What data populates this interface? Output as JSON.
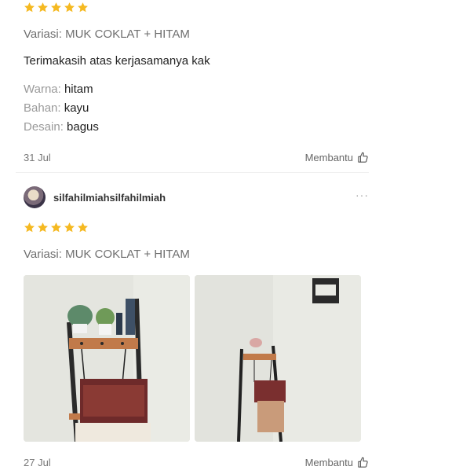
{
  "colors": {
    "star": "#f5b921",
    "text_primary": "#222222",
    "text_muted": "#6f6f6f",
    "attr_key": "#9a9a9a"
  },
  "reviews": [
    {
      "rating": 5,
      "variant": "Variasi: MUK COKLAT + HITAM",
      "comment": "Terimakasih atas kerjasamanya kak",
      "attributes": [
        {
          "key": "Warna:",
          "value": "hitam"
        },
        {
          "key": "Bahan:",
          "value": "kayu"
        },
        {
          "key": "Desain:",
          "value": "bagus"
        }
      ],
      "date": "31 Jul",
      "helpful_label": "Membantu",
      "helpful_icon": "thumbs-up-icon"
    },
    {
      "username": "silfahilmiahsilfahilmiah",
      "more_label": "···",
      "rating": 5,
      "variant": "Variasi: MUK COKLAT + HITAM",
      "photos": [
        {
          "subject": "shelf-photo-closeup"
        },
        {
          "subject": "shelf-photo-wide"
        }
      ],
      "date": "27 Jul",
      "helpful_label": "Membantu",
      "helpful_icon": "thumbs-up-icon"
    }
  ]
}
